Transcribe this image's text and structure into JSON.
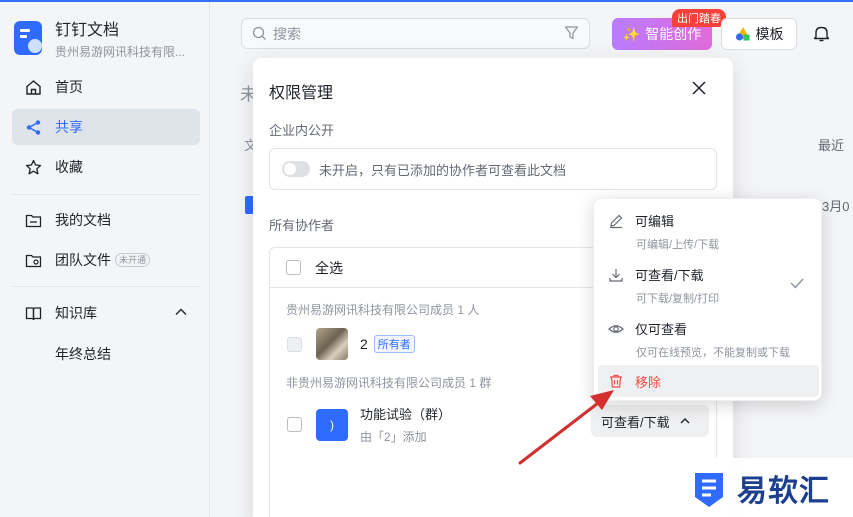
{
  "app": {
    "title": "钉钉文档",
    "org": "贵州易游网讯科技有限..."
  },
  "sidebar": {
    "items": [
      {
        "label": "首页",
        "icon": "home-icon"
      },
      {
        "label": "共享",
        "icon": "share-icon",
        "active": true
      },
      {
        "label": "收藏",
        "icon": "star-icon"
      },
      {
        "label": "我的文档",
        "icon": "folder-icon"
      },
      {
        "label": "团队文件",
        "icon": "team-folder-icon",
        "tag": "未开通"
      },
      {
        "label": "知识库",
        "icon": "book-icon"
      },
      {
        "label": "年终总结"
      }
    ]
  },
  "topbar": {
    "search_placeholder": "搜索",
    "ai_label": "智能创作",
    "ai_badge": "出门踏春",
    "template_label": "模板"
  },
  "background": {
    "partial_title": "未",
    "col_file": "文",
    "col_recent": "最近",
    "date": "3月0"
  },
  "dialog": {
    "title": "权限管理",
    "public_section": "企业内公开",
    "public_toggle_text": "未开启，只有已添加的协作者可查看此文档",
    "collab_section": "所有协作者",
    "select_all": "全选",
    "group_internal": "贵州易游网讯科技有限公司成员 1 人",
    "member1": {
      "name": "2",
      "badge": "所有者"
    },
    "group_external": "非贵州易游网讯科技有限公司成员 1 群",
    "member2": {
      "name": "功能试验（群）",
      "sub": "由「2」添加",
      "avatar_text": ")"
    },
    "permission_value": "可查看/下载"
  },
  "menu": {
    "items": [
      {
        "title": "可编辑",
        "desc": "可编辑/上传/下载",
        "icon": "pencil-icon"
      },
      {
        "title": "可查看/下载",
        "desc": "可下载/复制/打印",
        "icon": "download-icon",
        "checked": true
      },
      {
        "title": "仅可查看",
        "desc": "仅可在线预览，不能复制或下载",
        "icon": "eye-icon"
      },
      {
        "title": "移除",
        "icon": "trash-icon"
      }
    ]
  },
  "watermark": {
    "text": "易软汇"
  },
  "colors": {
    "accent": "#2f6bff",
    "danger": "#f54a45",
    "arrow": "#d32f2f"
  }
}
